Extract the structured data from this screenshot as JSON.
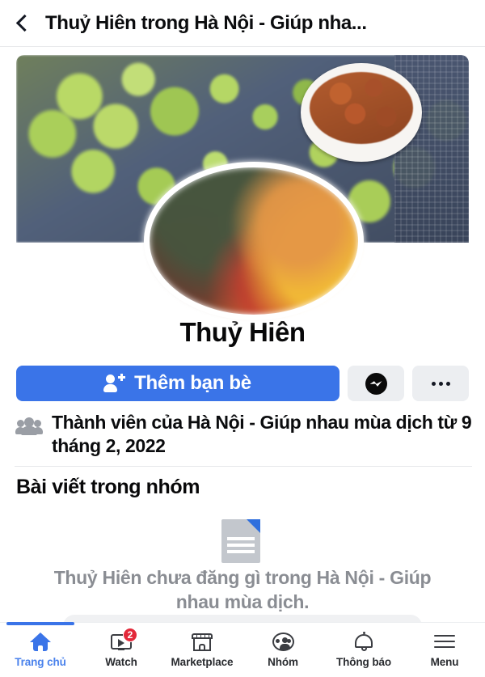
{
  "header": {
    "back_icon": "chevron-left-icon",
    "title": "Thuỷ Hiên trong Hà Nội - Giúp nha..."
  },
  "profile": {
    "cover_photo_alt": "cover-photo",
    "avatar_alt": "profile-avatar",
    "name": "Thuỷ Hiên"
  },
  "actions": {
    "add_friend_label": "Thêm bạn bè",
    "add_friend_icon": "person-add-icon",
    "add_friend_color": "#3a74e8",
    "messenger_icon": "messenger-icon",
    "more_icon": "ellipsis-icon"
  },
  "membership": {
    "icon": "group-people-icon",
    "text": "Thành viên của Hà Nội - Giúp nhau mùa dịch từ 9 tháng 2, 2022"
  },
  "posts": {
    "section_title": "Bài viết trong nhóm",
    "empty_icon": "document-icon",
    "empty_text": "Thuỷ Hiên chưa đăng gì trong Hà Nội - Giúp nhau mùa dịch."
  },
  "bottom_nav": {
    "active_color": "#3a74e8",
    "items": [
      {
        "label": "Trang chủ",
        "icon": "home-icon",
        "active": true,
        "badge": ""
      },
      {
        "label": "Watch",
        "icon": "watch-icon",
        "active": false,
        "badge": "2"
      },
      {
        "label": "Marketplace",
        "icon": "marketplace-icon",
        "active": false,
        "badge": ""
      },
      {
        "label": "Nhóm",
        "icon": "groups-icon",
        "active": false,
        "badge": ""
      },
      {
        "label": "Thông báo",
        "icon": "bell-icon",
        "active": false,
        "badge": ""
      },
      {
        "label": "Menu",
        "icon": "hamburger-icon",
        "active": false,
        "badge": ""
      }
    ]
  }
}
